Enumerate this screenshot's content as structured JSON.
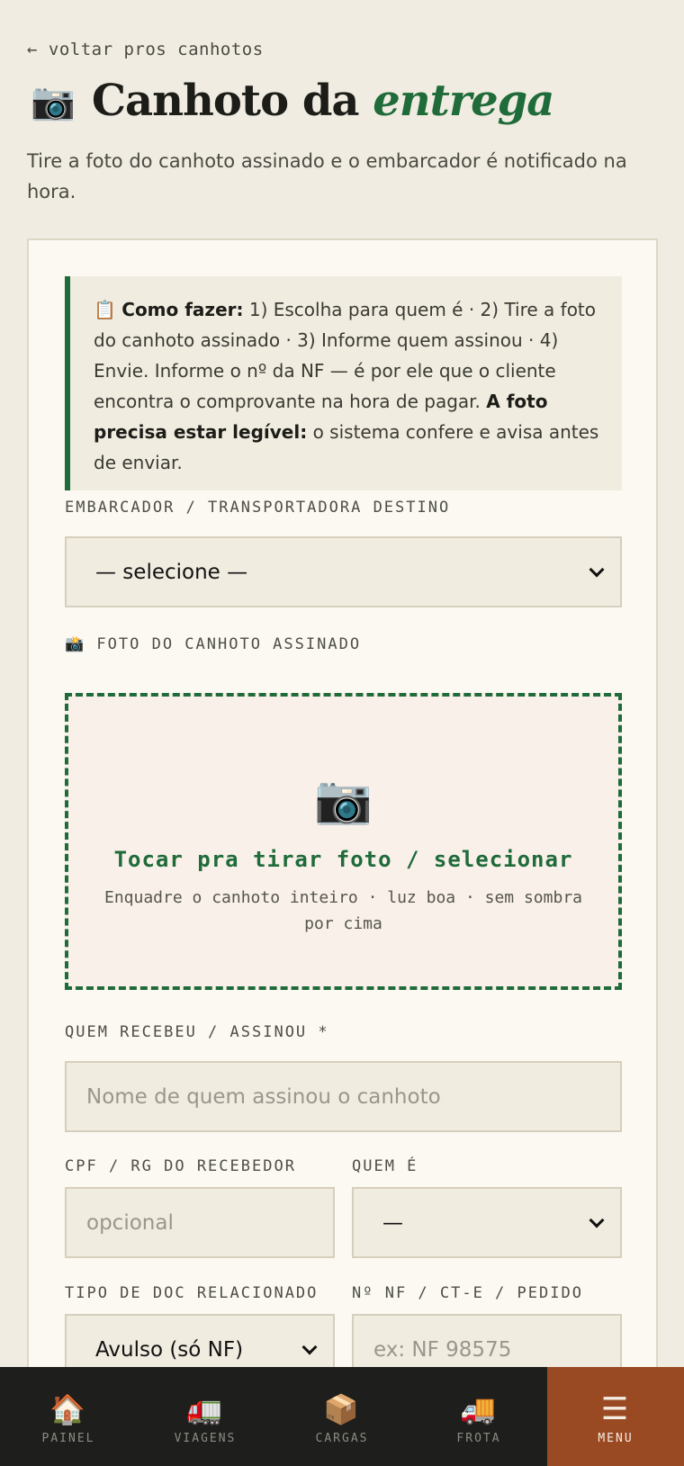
{
  "header": {
    "back_link": "← voltar pros canhotos",
    "title_emoji": "📷",
    "title_plain": "Canhoto da ",
    "title_emph": "entrega",
    "subtitle": "Tire a foto do canhoto assinado e o embarcador é notificado na hora."
  },
  "tip": {
    "icon": "📋",
    "how_label": "Como fazer:",
    "how_text": " 1) Escolha para quem é · 2) Tire a foto do canhoto assinado · 3) Informe quem assinou · 4) Envie. Informe o nº da NF — é por ele que o cliente encontra o comprovante na hora de pagar. ",
    "legible_label": "A foto precisa estar legível:",
    "legible_text": " o sistema confere e avisa antes de enviar."
  },
  "form": {
    "embarcador_label": "EMBARCADOR / TRANSPORTADORA DESTINO",
    "embarcador_value": "— selecione —",
    "photo_icon": "📸",
    "photo_label": "FOTO DO CANHOTO ASSINADO",
    "dropzone_emoji": "📷",
    "dropzone_title": "Tocar pra tirar foto / selecionar",
    "dropzone_hint": "Enquadre o canhoto inteiro · luz boa · sem sombra por cima",
    "recebedor_label": "QUEM RECEBEU / ASSINOU *",
    "recebedor_placeholder": "Nome de quem assinou o canhoto",
    "cpf_label": "CPF / RG DO RECEBEDOR",
    "cpf_placeholder": "opcional",
    "quem_label": "QUEM É",
    "quem_value": "—",
    "tipo_label": "TIPO DE DOC RELACIONADO",
    "tipo_value": "Avulso (só NF)",
    "nf_label": "Nº NF / CT-E / PEDIDO",
    "nf_placeholder": "ex: NF 98575"
  },
  "nav": [
    {
      "icon": "🏠",
      "label": "PAINEL"
    },
    {
      "icon": "🚛",
      "label": "VIAGENS"
    },
    {
      "icon": "📦",
      "label": "CARGAS"
    },
    {
      "icon": "🚚",
      "label": "FROTA"
    },
    {
      "icon": "☰",
      "label": "MENU"
    }
  ]
}
